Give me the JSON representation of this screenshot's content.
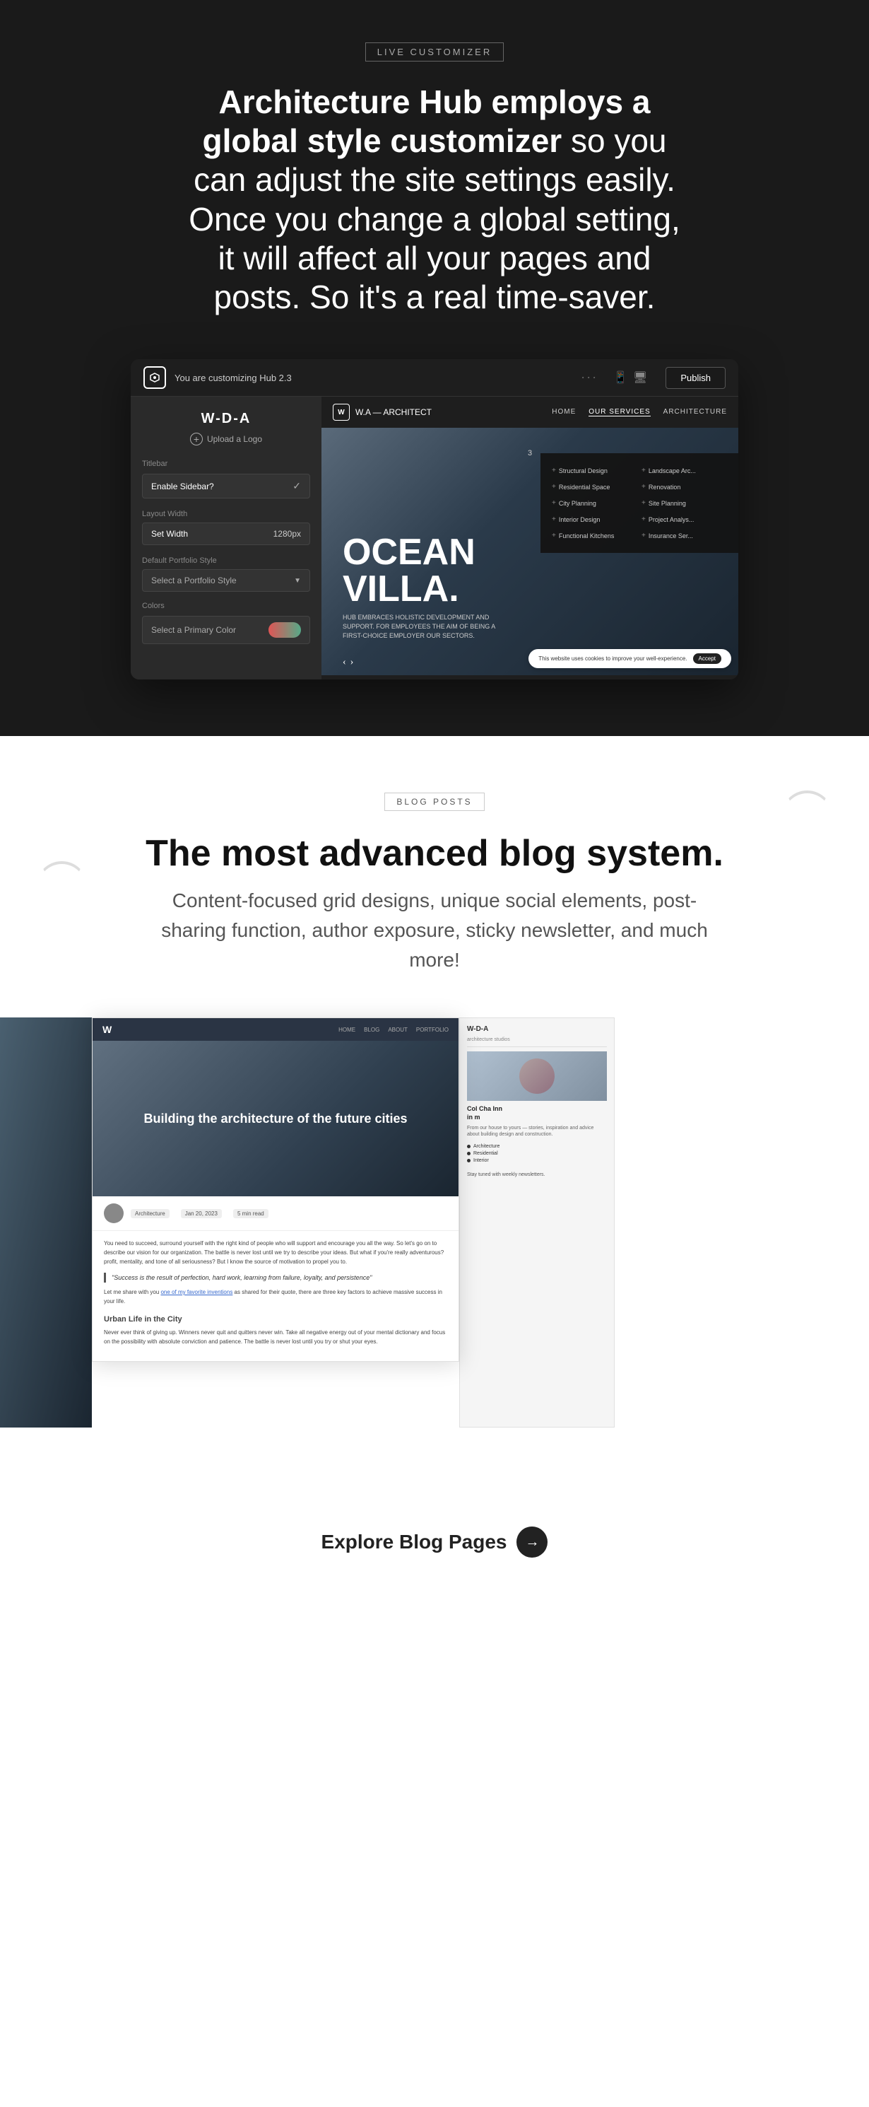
{
  "section1": {
    "label_tag": "LIVE CUSTOMIZER",
    "heading_bold": "Architecture Hub employs a global style customizer",
    "heading_light": " so you can adjust the site settings easily. Once you change a global setting, it will affect all your pages and posts. So it's a real time-saver.",
    "customizer": {
      "topbar_title": "You are customizing Hub 2.3",
      "publish_label": "Publish",
      "site_title": "W-D-A",
      "upload_logo_label": "Upload a Logo",
      "titlebar_label": "Titlebar",
      "sidebar_dropdown_label": "Enable Sidebar?",
      "layout_width_label": "Layout Width",
      "set_width_label": "Set Width",
      "set_width_value": "1280px",
      "default_portfolio_label": "Default Portfolio Style",
      "select_portfolio_label": "Select a Portfolio Style",
      "colors_label": "Colors",
      "primary_color_label": "Select a Primary Color"
    },
    "preview": {
      "logo_text": "W.A — ARCHITECT",
      "nav_home": "HOME",
      "nav_services": "OUR SERVICES",
      "nav_architecture": "ARCHITECTURE",
      "hero_title_line1": "OCEAN",
      "hero_title_line2": "VILLA.",
      "hero_subtitle": "HUB EMBRACES HOLISTIC DEVELOPMENT AND SUPPORT. FOR EMPLOYEES THE AIM OF BEING A FIRST-CHOICE EMPLOYER OUR SECTORS.",
      "number_badge": "3",
      "menu_items": [
        "Structural Design",
        "Landscape Arc...",
        "Residential Space",
        "Renovation",
        "City Planning",
        "Site Planning",
        "Interior Design",
        "Project Analys...",
        "Functional Kitchens",
        "Insurance Ser..."
      ],
      "cookie_text": "This website uses cookies to improve your well-experience.",
      "cookie_accept": "Accept"
    }
  },
  "section2": {
    "label_tag": "BLOG POSTS",
    "heading": "The most advanced blog system.",
    "subheading": "Content-focused grid designs, unique social elements, post-sharing function, author exposure, sticky newsletter, and much more!",
    "preview": {
      "nav_logo": "W",
      "nav_links": [
        "HOME",
        "BLOG",
        "ABOUT",
        "PORTFOLIO"
      ],
      "hero_title": "Building the architecture of the future cities",
      "article_body_1": "You need to succeed, surround yourself with the right kind of people who will support and encourage you all the way. So let's go on to describe our vision for our organization. The battle is never lost until we try to describe your ideas. But what if you're really adventurous? profit, mentality, and tone of all seriousness? But I know the source of motivation to propel you to.",
      "quote": "\"Success is the result of perfection, hard work, learning from failure, loyalty, and persistence\"",
      "article_body_2": "Let me share with you one of my favorite inventions as shared for their quote, there are three key factors to achieve massive success in your life.",
      "article_heading": "Urban Life in the City",
      "article_body_3": "Never ever think of giving up. Winners never quit and quitters never win. Take all negative energy out of your mental dictionary and focus on the possibility with absolute conviction and patience. The battle is never lost until you try or shut your eyes.",
      "right_sidebar_title": "Col Cha Inn",
      "right_sidebar_subtitle": "in m",
      "sidebar_logo": "W-D-A",
      "subscribe_text": "Stay tuned with weekly newsletters."
    },
    "explore_label": "Explore Blog Pages"
  }
}
